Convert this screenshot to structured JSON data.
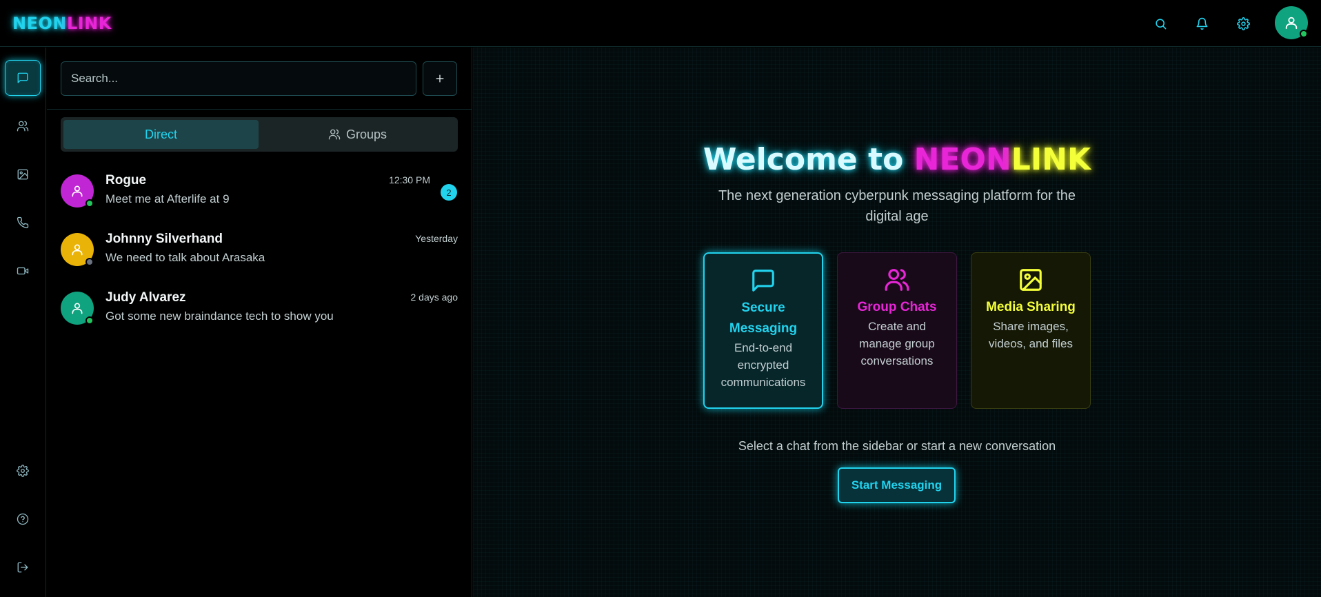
{
  "app": {
    "logo_part1": "NEON",
    "logo_part2": "LINK"
  },
  "header": {
    "icons": [
      "search-icon",
      "bell-icon",
      "gear-icon",
      "user-avatar"
    ]
  },
  "rail": {
    "top_items": [
      "chats-icon",
      "contacts-icon",
      "media-icon",
      "phone-icon",
      "video-icon"
    ],
    "bottom_items": [
      "settings-icon",
      "help-icon",
      "logout-icon"
    ]
  },
  "search": {
    "placeholder": "Search..."
  },
  "tabs": {
    "direct": "Direct",
    "groups": "Groups"
  },
  "chats": [
    {
      "name": "Rogue",
      "message": "Meet me at Afterlife at 9",
      "time": "12:30 PM",
      "unread": "2",
      "avatar_color": "#c026d3",
      "status": "online"
    },
    {
      "name": "Johnny Silverhand",
      "message": "We need to talk about Arasaka",
      "time": "Yesterday",
      "avatar_color": "#eab308",
      "status": "offline"
    },
    {
      "name": "Judy Alvarez",
      "message": "Got some new braindance tech to show you",
      "time": "2 days ago",
      "avatar_color": "#10a37f",
      "status": "online"
    }
  ],
  "welcome": {
    "prefix": "Welcome to ",
    "neon": "NEON",
    "link": "LINK",
    "subtitle": "The next generation cyberpunk messaging platform for the digital age"
  },
  "features": [
    {
      "title": "Secure Messaging",
      "desc": "End-to-end encrypted communications",
      "icon": "message-icon",
      "color": "#22d3ee"
    },
    {
      "title": "Group Chats",
      "desc": "Create and manage group conversations",
      "icon": "users-icon",
      "color": "#e925d8"
    },
    {
      "title": "Media Sharing",
      "desc": "Share images, videos, and files",
      "icon": "image-icon",
      "color": "#f4ff3a"
    }
  ],
  "main": {
    "hint": "Select a chat from the sidebar or start a new conversation",
    "start_button": "Start Messaging"
  },
  "colors": {
    "accent_cyan": "#22d3ee",
    "accent_magenta": "#e925d8",
    "accent_yellow": "#f4ff3a",
    "online": "#22c55e",
    "offline": "#6b7280"
  }
}
